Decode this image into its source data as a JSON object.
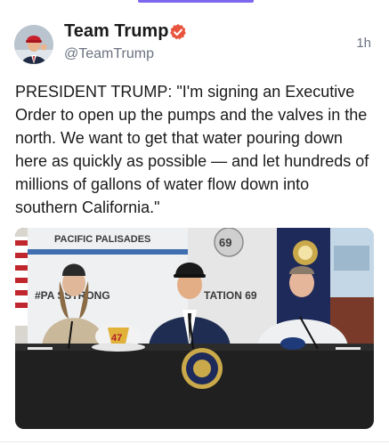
{
  "post": {
    "author_name": "Team Trump",
    "author_handle": "@TeamTrump",
    "timestamp": "1h",
    "verified": true,
    "text": "PRESIDENT TRUMP: \"I'm signing an Executive Order to open up the pumps and the valves in the north. We want to get that water pouring down here as quickly as possible — and let hundreds of millions of gallons of water flow down into southern California.\""
  },
  "media": {
    "banner_text": "PACIFIC PALISADES",
    "hashtag_text": "#PA   SSTRONG",
    "station_text": "TATION 69",
    "badge_number": "69",
    "helmet_number": "47"
  },
  "colors": {
    "verified_badge": "#e8553e",
    "accent_indicator": "#7b68ee",
    "handle_gray": "#6b7280"
  },
  "icons": {
    "verified": "verified-badge-icon",
    "avatar": "avatar"
  }
}
